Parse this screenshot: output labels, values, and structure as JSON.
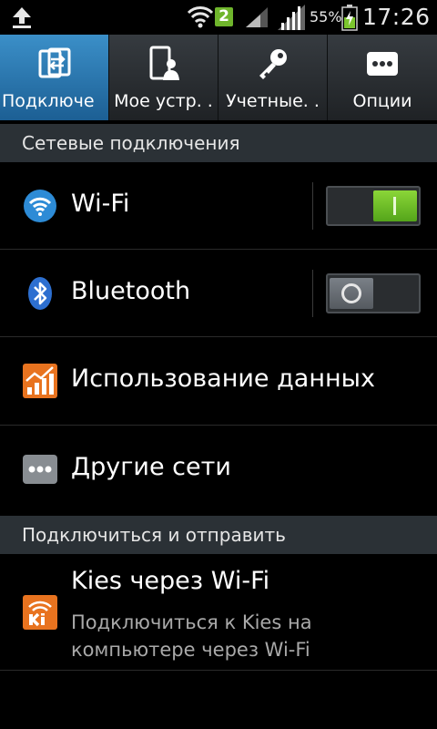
{
  "status_bar": {
    "sim_slot": "2",
    "battery_percent": "55%",
    "battery_level": 0.55,
    "time": "17:26",
    "icons": [
      "upload-icon",
      "wifi-icon",
      "signal-icon",
      "signal-icon",
      "battery-charging-icon"
    ]
  },
  "tabs": [
    {
      "label": "Подключе",
      "icon": "connections-icon",
      "active": true
    },
    {
      "label": "Мое устр. .",
      "icon": "my-device-icon",
      "active": false
    },
    {
      "label": "Учетные. .",
      "icon": "accounts-key-icon",
      "active": false
    },
    {
      "label": "Опции",
      "icon": "more-options-icon",
      "active": false
    }
  ],
  "sections": {
    "network": {
      "title": "Сетевые подключения"
    },
    "connect_share": {
      "title": "Подключиться и отправить"
    }
  },
  "rows": {
    "wifi": {
      "label": "Wi-Fi",
      "icon": "wifi-icon",
      "toggle_on": true
    },
    "bluetooth": {
      "label": "Bluetooth",
      "icon": "bluetooth-icon",
      "toggle_on": false
    },
    "data_usage": {
      "label": "Использование данных",
      "icon": "data-usage-icon"
    },
    "more_networks": {
      "label": "Другие сети",
      "icon": "more-networks-icon"
    },
    "kies": {
      "label": "Kies через Wi-Fi",
      "subtitle": "Подключиться к Kies на компьютере через Wi-Fi",
      "icon": "kies-wifi-icon"
    }
  },
  "colors": {
    "active_tab": "#2d7fbd",
    "toggle_on": "#6fc12a",
    "section_header_bg": "#2b3136",
    "sim_badge": "#6fb52c",
    "orange_icon": "#e8731f"
  }
}
